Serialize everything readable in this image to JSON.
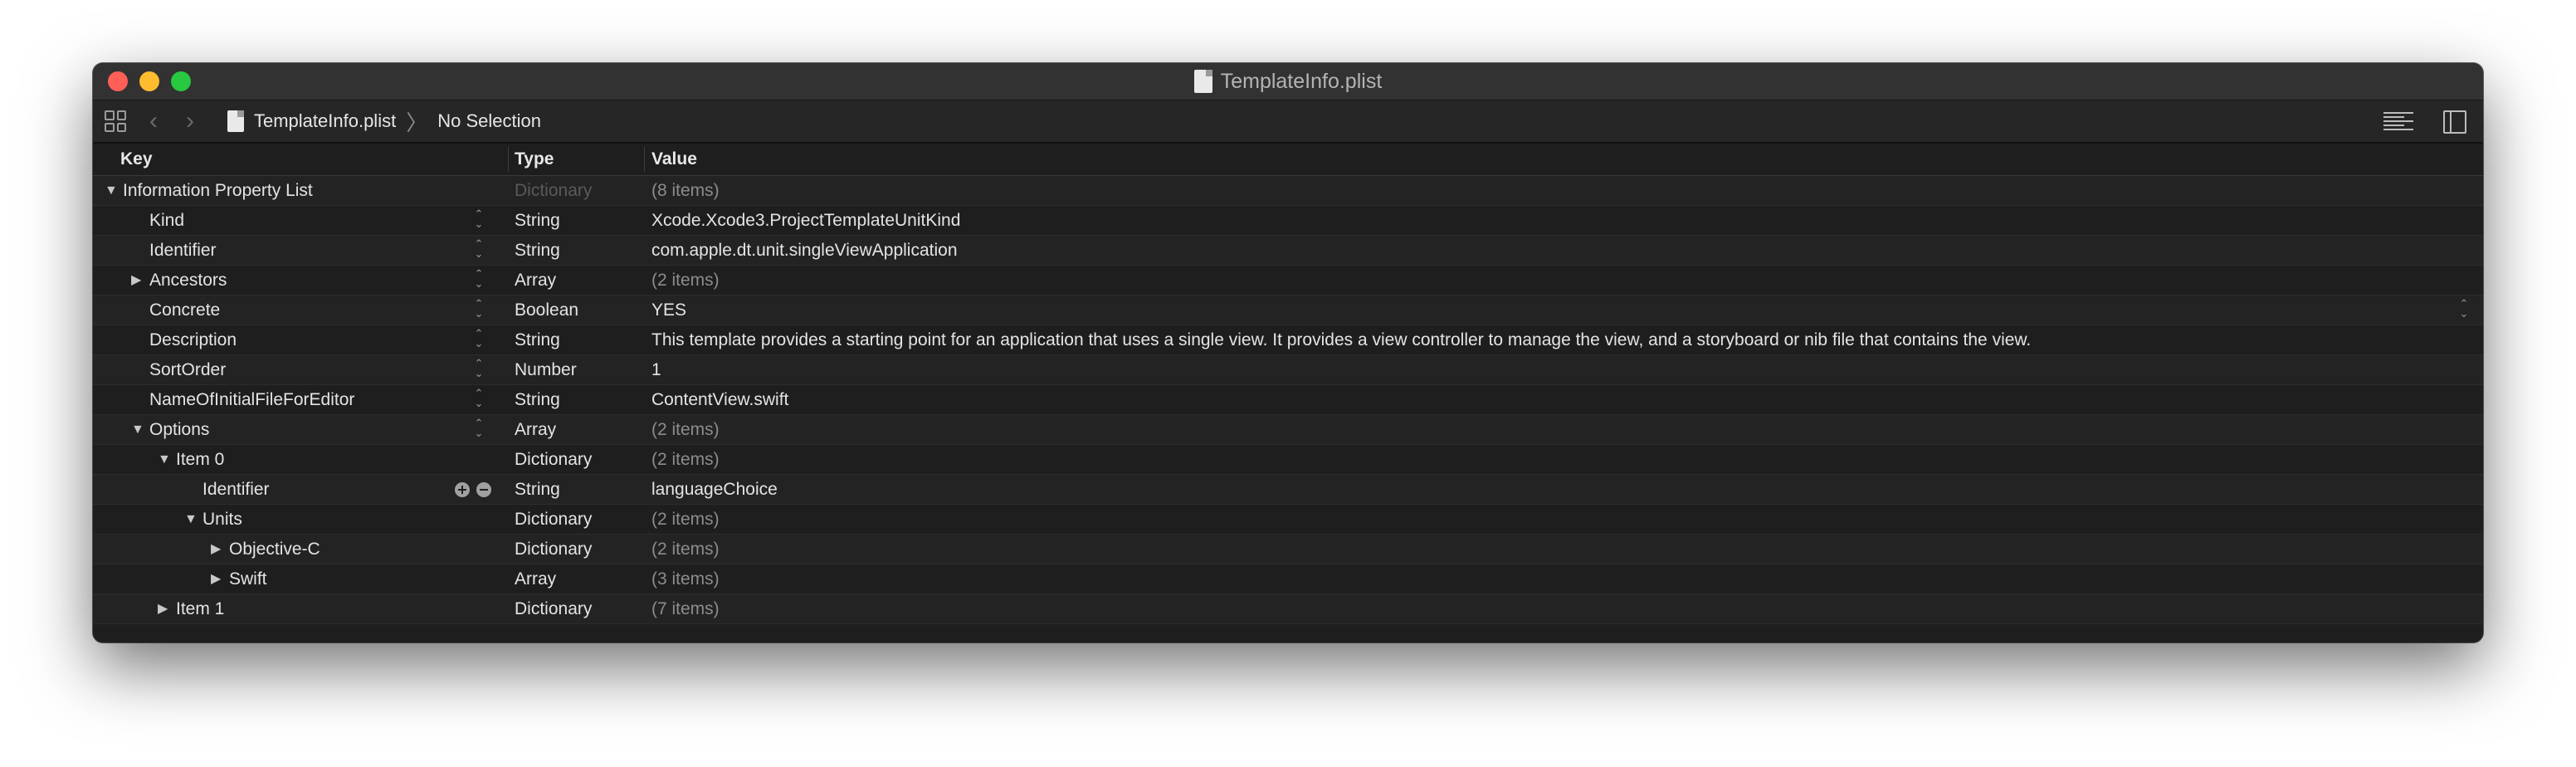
{
  "window": {
    "title": "TemplateInfo.plist",
    "toolbar": {
      "file_name": "TemplateInfo.plist",
      "separator": "〉",
      "selection": "No Selection"
    }
  },
  "columns": {
    "key": "Key",
    "type": "Type",
    "value": "Value"
  },
  "rows": [
    {
      "key": "Information Property List",
      "type": "Dictionary",
      "value": "(8 items)"
    },
    {
      "key": "Kind",
      "type": "String",
      "value": "Xcode.Xcode3.ProjectTemplateUnitKind"
    },
    {
      "key": "Identifier",
      "type": "String",
      "value": "com.apple.dt.unit.singleViewApplication"
    },
    {
      "key": "Ancestors",
      "type": "Array",
      "value": "(2 items)"
    },
    {
      "key": "Concrete",
      "type": "Boolean",
      "value": "YES"
    },
    {
      "key": "Description",
      "type": "String",
      "value": "This template provides a starting point for an application that uses a single view. It provides a view controller to manage the view, and a storyboard or nib file that contains the view."
    },
    {
      "key": "SortOrder",
      "type": "Number",
      "value": "1"
    },
    {
      "key": "NameOfInitialFileForEditor",
      "type": "String",
      "value": "ContentView.swift"
    },
    {
      "key": "Options",
      "type": "Array",
      "value": "(2 items)"
    },
    {
      "key": "Item 0",
      "type": "Dictionary",
      "value": "(2 items)"
    },
    {
      "key": "Identifier",
      "type": "String",
      "value": "languageChoice"
    },
    {
      "key": "Units",
      "type": "Dictionary",
      "value": "(2 items)"
    },
    {
      "key": "Objective-C",
      "type": "Dictionary",
      "value": "(2 items)"
    },
    {
      "key": "Swift",
      "type": "Array",
      "value": "(3 items)"
    },
    {
      "key": "Item 1",
      "type": "Dictionary",
      "value": "(7 items)"
    }
  ],
  "icons": {
    "disclosure_open": "▼",
    "disclosure_closed": "▶",
    "stepper": "⌃⌄",
    "back": "‹",
    "forward": "›"
  },
  "colors": {
    "close": "#fe5f57",
    "minimize": "#febc2e",
    "maximize": "#28c840",
    "background": "#1e1e1e"
  }
}
